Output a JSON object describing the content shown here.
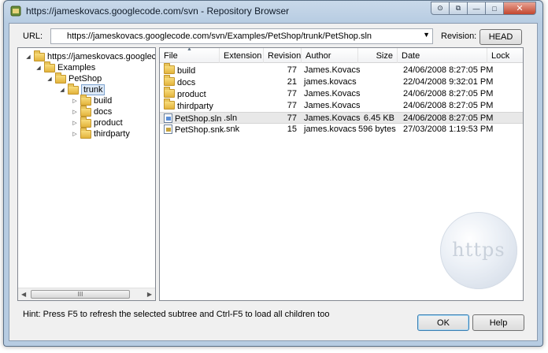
{
  "window": {
    "title": "https://jameskovacs.googlecode.com/svn - Repository Browser",
    "buttons": {
      "restore_a": "⊙",
      "restore_b": "⧉",
      "minimize": "—",
      "maximize": "□",
      "close": "✕"
    }
  },
  "toolbar": {
    "url_label": "URL:",
    "url_value": "https://jameskovacs.googlecode.com/svn/Examples/PetShop/trunk/PetShop.sln",
    "revision_label": "Revision:",
    "head_button": "HEAD"
  },
  "tree": {
    "items": [
      {
        "label": "https://jameskovacs.googlecode.com/svn",
        "expander": "◢"
      },
      {
        "label": "Examples",
        "expander": "◢"
      },
      {
        "label": "PetShop",
        "expander": "◢"
      },
      {
        "label": "trunk",
        "expander": "◢"
      },
      {
        "label": "build",
        "expander": "▷"
      },
      {
        "label": "docs",
        "expander": "▷"
      },
      {
        "label": "product",
        "expander": "▷"
      },
      {
        "label": "thirdparty",
        "expander": "▷"
      }
    ],
    "scroll_left": "◀",
    "scroll_right": "▶",
    "scroll_grip": "III"
  },
  "list": {
    "columns": [
      "File",
      "Extension",
      "Revision",
      "Author",
      "Size",
      "Date",
      "Lock"
    ],
    "rows": [
      {
        "file": "build",
        "extension": "",
        "revision": "77",
        "author": "James.Kovacs",
        "size": "",
        "date": "24/06/2008 8:27:05 PM",
        "lock": ""
      },
      {
        "file": "docs",
        "extension": "",
        "revision": "21",
        "author": "james.kovacs",
        "size": "",
        "date": "22/04/2008 9:32:01 PM",
        "lock": ""
      },
      {
        "file": "product",
        "extension": "",
        "revision": "77",
        "author": "James.Kovacs",
        "size": "",
        "date": "24/06/2008 8:27:05 PM",
        "lock": ""
      },
      {
        "file": "thirdparty",
        "extension": "",
        "revision": "77",
        "author": "James.Kovacs",
        "size": "",
        "date": "24/06/2008 8:27:05 PM",
        "lock": ""
      },
      {
        "file": "PetShop.sln",
        "extension": ".sln",
        "revision": "77",
        "author": "James.Kovacs",
        "size": "6.45 KB",
        "date": "24/06/2008 8:27:05 PM",
        "lock": ""
      },
      {
        "file": "PetShop.snk",
        "extension": ".snk",
        "revision": "15",
        "author": "james.kovacs",
        "size": "596 bytes",
        "date": "27/03/2008 1:19:53 PM",
        "lock": ""
      }
    ],
    "watermark": "https"
  },
  "footer": {
    "hint": "Hint: Press F5 to refresh the selected subtree and Ctrl-F5 to load all children too",
    "ok_button": "OK",
    "help_button": "Help"
  },
  "colors": {
    "selection_border": "#7da2ce",
    "selection_fill": "#dce9f8",
    "title_bar": "#c9d9ea"
  }
}
